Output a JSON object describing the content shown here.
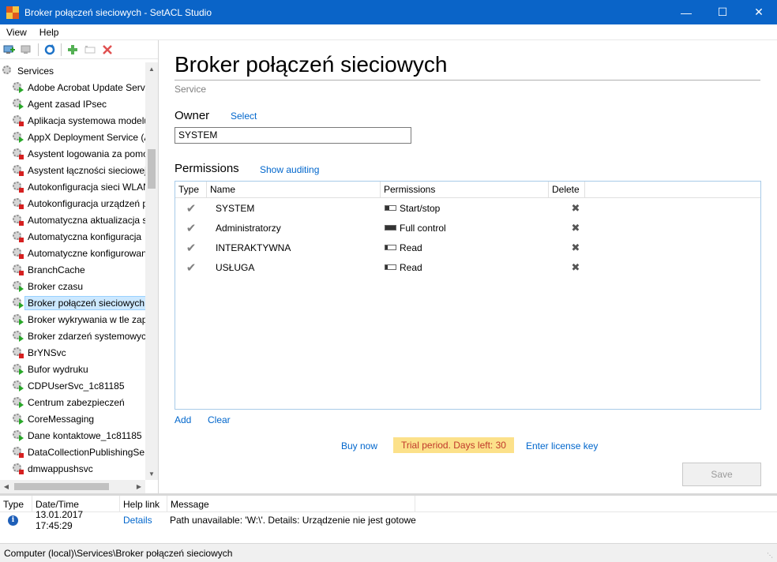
{
  "window": {
    "title": "Broker połączeń sieciowych - SetACL Studio"
  },
  "menu": [
    {
      "label": "View"
    },
    {
      "label": "Help"
    }
  ],
  "tree": {
    "root": "Services",
    "items": [
      {
        "label": "Adobe Acrobat Update Servi",
        "status": "run"
      },
      {
        "label": "Agent zasad IPsec",
        "status": "run"
      },
      {
        "label": "Aplikacja systemowa modelu",
        "status": "stop"
      },
      {
        "label": "AppX Deployment Service (A",
        "status": "run"
      },
      {
        "label": "Asystent logowania za pomoc",
        "status": "stop"
      },
      {
        "label": "Asystent łączności sieciowej",
        "status": "stop"
      },
      {
        "label": "Autokonfiguracja sieci WLAN",
        "status": "stop"
      },
      {
        "label": "Autokonfiguracja urządzeń p",
        "status": "stop"
      },
      {
        "label": "Automatyczna aktualizacja s",
        "status": "stop"
      },
      {
        "label": "Automatyczna konfiguracja",
        "status": "stop"
      },
      {
        "label": "Automatyczne konfigurowan",
        "status": "stop"
      },
      {
        "label": "BranchCache",
        "status": "stop"
      },
      {
        "label": "Broker czasu",
        "status": "run"
      },
      {
        "label": "Broker połączeń sieciowych",
        "status": "run",
        "selected": true
      },
      {
        "label": "Broker wykrywania w tle zapy",
        "status": "run"
      },
      {
        "label": "Broker zdarzeń systemowych",
        "status": "run"
      },
      {
        "label": "BrYNSvc",
        "status": "stop"
      },
      {
        "label": "Bufor wydruku",
        "status": "run"
      },
      {
        "label": "CDPUserSvc_1c81185",
        "status": "run"
      },
      {
        "label": "Centrum zabezpieczeń",
        "status": "run"
      },
      {
        "label": "CoreMessaging",
        "status": "run"
      },
      {
        "label": "Dane kontaktowe_1c81185",
        "status": "run"
      },
      {
        "label": "DataCollectionPublishingSer",
        "status": "stop"
      },
      {
        "label": "dmwappushsvc",
        "status": "stop"
      }
    ]
  },
  "object": {
    "title": "Broker połączeń sieciowych",
    "type": "Service",
    "owner_label": "Owner",
    "owner_select": "Select",
    "owner_value": "SYSTEM",
    "permissions_label": "Permissions",
    "show_auditing": "Show auditing"
  },
  "permissions": {
    "headers": {
      "type": "Type",
      "name": "Name",
      "permissions": "Permissions",
      "delete": "Delete"
    },
    "rows": [
      {
        "name": "SYSTEM",
        "permission": "Start/stop",
        "level": 0.4
      },
      {
        "name": "Administratorzy",
        "permission": "Full control",
        "level": 1.0
      },
      {
        "name": "INTERAKTYWNA",
        "permission": "Read",
        "level": 0.25
      },
      {
        "name": "USŁUGA",
        "permission": "Read",
        "level": 0.25
      }
    ]
  },
  "actions": {
    "add": "Add",
    "clear": "Clear",
    "buy_now": "Buy now",
    "trial": "Trial period. Days left: 30",
    "license": "Enter license key",
    "save": "Save"
  },
  "log": {
    "headers": {
      "type": "Type",
      "datetime": "Date/Time",
      "help": "Help link",
      "message": "Message"
    },
    "rows": [
      {
        "datetime": "13.01.2017 17:45:29",
        "help": "Details",
        "message": "Path unavailable: 'W:\\'. Details: Urządzenie nie jest gotowe"
      }
    ]
  },
  "statusbar": {
    "path": "Computer (local)\\Services\\Broker połączeń sieciowych"
  },
  "colors": {
    "titlebar": "#0a64c8",
    "link": "#0066cc",
    "trial_bg": "#fce18a",
    "trial_text": "#c0392b"
  }
}
